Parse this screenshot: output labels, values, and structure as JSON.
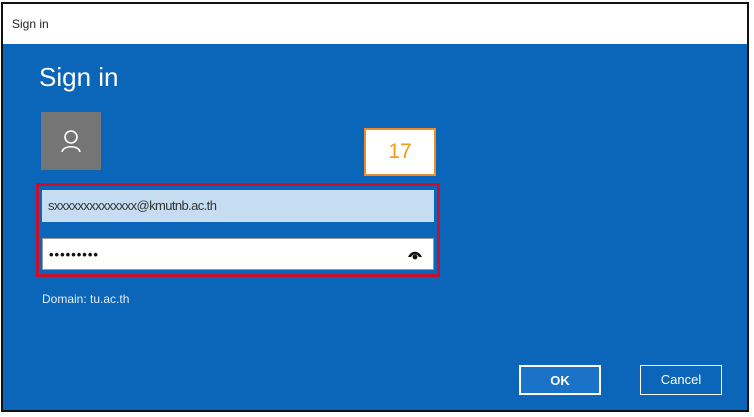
{
  "window": {
    "title": "Sign in"
  },
  "dialog": {
    "heading": "Sign in"
  },
  "annotation": {
    "number": "17"
  },
  "form": {
    "username_value": "sxxxxxxxxxxxxxx@kmutnb.ac.th",
    "password_masked": "•••••••••",
    "domain_text": "Domain: tu.ac.th"
  },
  "buttons": {
    "ok_label": "OK",
    "cancel_label": "Cancel"
  },
  "colors": {
    "dialog_background": "#0b65b8",
    "annotation_border": "#f08a24",
    "highlight_border": "#c8102e"
  },
  "icons": {
    "avatar": "user-icon",
    "reveal": "eye-icon"
  }
}
